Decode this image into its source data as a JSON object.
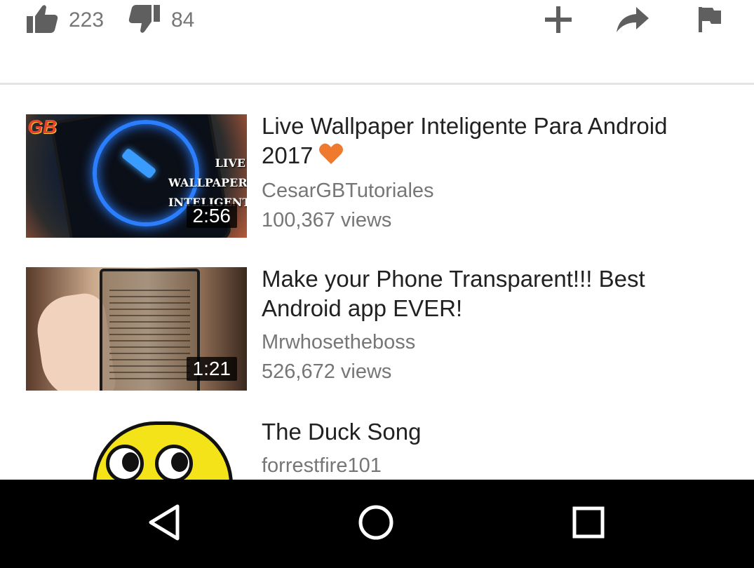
{
  "actions": {
    "like_count": "223",
    "dislike_count": "84",
    "icons": [
      "thumbs-up-icon",
      "thumbs-down-icon",
      "add-to-playlist-icon",
      "share-icon",
      "flag-icon"
    ]
  },
  "videos": [
    {
      "title": "Live Wallpaper Inteligente Para Android 2017",
      "channel": "CesarGBTutoriales",
      "views": "100,367 views",
      "duration": "2:56",
      "thumb_text": "LIVE WALLPAPER INTELIGENTE",
      "thumb_logo": "GB"
    },
    {
      "title": "Make your Phone Transparent!!! Best Android app EVER!",
      "channel": "Mrwhosetheboss",
      "views": "526,672 views",
      "duration": "1:21"
    },
    {
      "title": "The Duck Song",
      "channel": "forrestfire101"
    }
  ],
  "colors": {
    "heart": "#ef7a2e",
    "secondary_text": "#767676",
    "primary_text": "#212121",
    "icon": "#5f5f5f",
    "nav_bar": "#000000"
  },
  "nav": {
    "icons": [
      "back-icon",
      "home-icon",
      "recent-apps-icon"
    ]
  }
}
